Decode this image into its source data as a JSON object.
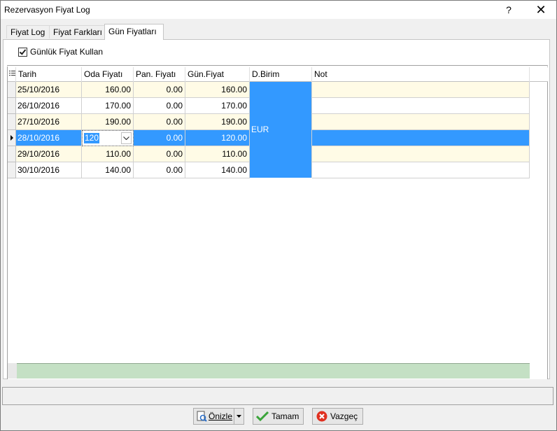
{
  "window": {
    "title": "Rezervasyon Fiyat Log",
    "help": "?",
    "close": "✕"
  },
  "tabs": [
    {
      "label": "Fiyat Log"
    },
    {
      "label": "Fiyat Farkları"
    },
    {
      "label": "Gün Fiyatları",
      "active": true
    }
  ],
  "checkbox": {
    "label": "Günlük Fiyat Kullan",
    "checked": true
  },
  "grid": {
    "columns": [
      "Tarih",
      "Oda Fiyatı",
      "Pan. Fiyatı",
      "Gün.Fiyat",
      "D.Birim",
      "Not"
    ],
    "currency": "EUR",
    "editor_value": "120",
    "rows": [
      {
        "tarih": "25/10/2016",
        "oda": "160.00",
        "pan": "0.00",
        "gun": "160.00",
        "not": ""
      },
      {
        "tarih": "26/10/2016",
        "oda": "170.00",
        "pan": "0.00",
        "gun": "170.00",
        "not": ""
      },
      {
        "tarih": "27/10/2016",
        "oda": "190.00",
        "pan": "0.00",
        "gun": "190.00",
        "not": ""
      },
      {
        "tarih": "28/10/2016",
        "oda": "120",
        "pan": "0.00",
        "gun": "120.00",
        "not": "",
        "selected": true
      },
      {
        "tarih": "29/10/2016",
        "oda": "110.00",
        "pan": "0.00",
        "gun": "110.00",
        "not": ""
      },
      {
        "tarih": "30/10/2016",
        "oda": "140.00",
        "pan": "0.00",
        "gun": "140.00",
        "not": ""
      }
    ]
  },
  "buttons": {
    "preview": "Önizle",
    "ok": "Tamam",
    "cancel": "Vazgeç"
  },
  "colors": {
    "row_alt": "#fffbe6",
    "selected": "#3399ff",
    "footer": "#c4e0c4",
    "currency_cell": "#3399ff"
  }
}
